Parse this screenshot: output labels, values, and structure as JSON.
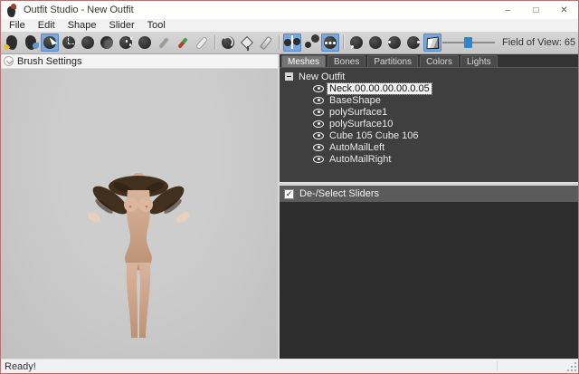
{
  "window": {
    "title": "Outfit Studio - New Outfit",
    "controls": [
      {
        "name": "minimize-button",
        "glyph": "–"
      },
      {
        "name": "maximize-button",
        "glyph": "□"
      },
      {
        "name": "close-button",
        "glyph": "✕"
      }
    ]
  },
  "menu": {
    "items": [
      {
        "name": "menu-file",
        "label": "File"
      },
      {
        "name": "menu-edit",
        "label": "Edit"
      },
      {
        "name": "menu-shape",
        "label": "Shape"
      },
      {
        "name": "menu-slider",
        "label": "Slider"
      },
      {
        "name": "menu-tool",
        "label": "Tool"
      }
    ]
  },
  "toolbar": {
    "tools": [
      {
        "name": "load-project-icon",
        "type": "logo-yellow"
      },
      {
        "name": "load-reference-icon",
        "type": "logo-blue"
      },
      {
        "name": "select-brush-icon",
        "type": "sphere-cursor",
        "selected": true
      },
      {
        "name": "mask-brush-icon",
        "type": "sphere-dash"
      },
      {
        "name": "inflate-brush-icon",
        "type": "sphere"
      },
      {
        "name": "deflate-brush-icon",
        "type": "sphere-crescent"
      },
      {
        "name": "move-brush-icon",
        "type": "sphere-dots"
      },
      {
        "name": "smooth-brush-icon",
        "type": "sphere"
      },
      {
        "name": "weight-brush-icon",
        "type": "brush-gray"
      },
      {
        "name": "color-brush-icon",
        "type": "brush-color"
      },
      {
        "name": "alpha-brush-icon",
        "type": "brush-white"
      },
      {
        "name": "toolbar-separator",
        "type": "sep",
        "interactable": false
      },
      {
        "name": "transform-tool-icon",
        "type": "sphere-rotate"
      },
      {
        "name": "pin-vertex-icon",
        "type": "pin"
      },
      {
        "name": "edit-vertex-icon",
        "type": "pencil"
      },
      {
        "name": "toolbar-separator",
        "type": "sep",
        "interactable": false
      },
      {
        "name": "x-mirror-toggle-icon",
        "type": "mirror",
        "selected": true
      },
      {
        "name": "connected-only-toggle-icon",
        "type": "pair"
      },
      {
        "name": "brush-collision-toggle-icon",
        "type": "sphere-ellipsis",
        "selected": true
      },
      {
        "name": "toolbar-separator",
        "type": "sep",
        "interactable": false
      },
      {
        "name": "light-frontal-toggle-icon",
        "type": "sphere-dot-bl"
      },
      {
        "name": "light-directional0-toggle-icon",
        "type": "sphere"
      },
      {
        "name": "light-directional1-toggle-icon",
        "type": "sphere-dot-l"
      },
      {
        "name": "light-directional2-toggle-icon",
        "type": "sphere-dot-r"
      },
      {
        "name": "perspective-toggle-icon",
        "type": "cube",
        "selected": true
      }
    ],
    "field_of_view": {
      "label": "Field of View: 65",
      "value": 65
    }
  },
  "left_panel": {
    "header": "Brush Settings"
  },
  "right_panel": {
    "tabs": [
      {
        "name": "tab-meshes",
        "label": "Meshes",
        "active": true
      },
      {
        "name": "tab-bones",
        "label": "Bones"
      },
      {
        "name": "tab-partitions",
        "label": "Partitions"
      },
      {
        "name": "tab-colors",
        "label": "Colors"
      },
      {
        "name": "tab-lights",
        "label": "Lights"
      }
    ],
    "tree": {
      "root": "New Outfit",
      "items": [
        {
          "name": "tree-item-neck",
          "label": "Neck.00.00.00.00.0.05",
          "selected": true
        },
        {
          "name": "tree-item-baseshape",
          "label": "BaseShape"
        },
        {
          "name": "tree-item-polysurface1",
          "label": "polySurface1"
        },
        {
          "name": "tree-item-polysurface10",
          "label": "polySurface10"
        },
        {
          "name": "tree-item-cube105-106",
          "label": "Cube 105 Cube 106"
        },
        {
          "name": "tree-item-automailleft",
          "label": "AutoMailLeft"
        },
        {
          "name": "tree-item-automailright",
          "label": "AutoMailRight"
        }
      ]
    },
    "sliders_header": {
      "label": "De-/Select Sliders",
      "checked": true,
      "check_glyph": "✓"
    }
  },
  "statusbar": {
    "text": "Ready!"
  },
  "colors": {
    "accent_selection": "#7ca7da",
    "window_border": "#b47272",
    "panel_dark": "#3f3f3f",
    "sliders_panel": "#2d2d2d",
    "viewport_bg": "#c6c6c6",
    "tree_selection_bg": "#f2f2f2",
    "fov_thumb": "#2e86d2"
  }
}
